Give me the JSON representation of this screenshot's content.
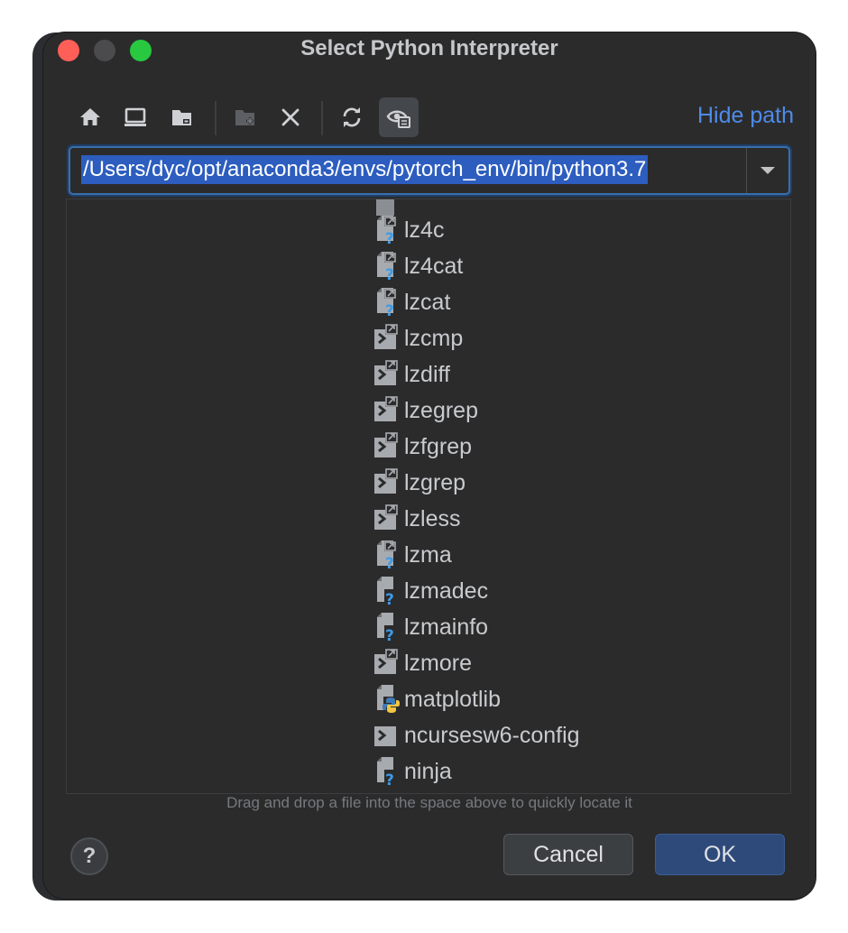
{
  "window": {
    "title": "Select Python Interpreter"
  },
  "toolbar": {
    "icons": [
      "home-icon",
      "desktop-icon",
      "project-folder-icon",
      "new-folder-icon",
      "delete-icon",
      "refresh-icon",
      "show-hidden-icon"
    ],
    "hide_path_label": "Hide path"
  },
  "path_field": {
    "value": "/Users/dyc/opt/anaconda3/envs/pytorch_env/bin/python3.7"
  },
  "files": [
    {
      "name": "lz4c",
      "icon": "unknown-symlink"
    },
    {
      "name": "lz4cat",
      "icon": "unknown-symlink"
    },
    {
      "name": "lzcat",
      "icon": "unknown-symlink"
    },
    {
      "name": "lzcmp",
      "icon": "exec-symlink"
    },
    {
      "name": "lzdiff",
      "icon": "exec-symlink"
    },
    {
      "name": "lzegrep",
      "icon": "exec-symlink"
    },
    {
      "name": "lzfgrep",
      "icon": "exec-symlink"
    },
    {
      "name": "lzgrep",
      "icon": "exec-symlink"
    },
    {
      "name": "lzless",
      "icon": "exec-symlink"
    },
    {
      "name": "lzma",
      "icon": "unknown-symlink"
    },
    {
      "name": "lzmadec",
      "icon": "unknown"
    },
    {
      "name": "lzmainfo",
      "icon": "unknown"
    },
    {
      "name": "lzmore",
      "icon": "exec-symlink"
    },
    {
      "name": "matplotlib",
      "icon": "python"
    },
    {
      "name": "ncursesw6-config",
      "icon": "exec"
    },
    {
      "name": "ninja",
      "icon": "unknown"
    }
  ],
  "hint": "Drag and drop a file into the space above to quickly locate it",
  "buttons": {
    "help": "?",
    "cancel": "Cancel",
    "ok": "OK"
  },
  "colors": {
    "accent": "#4e8be8",
    "selection": "#2c5dbf",
    "ok_button": "#2e4a7a"
  }
}
